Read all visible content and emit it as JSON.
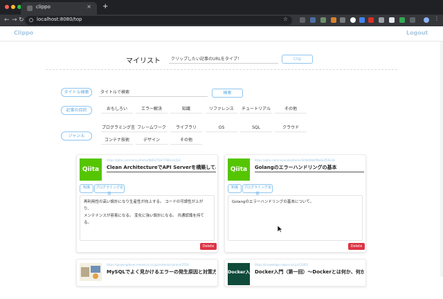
{
  "browser": {
    "tab_title": "clippo",
    "tab_close": "×",
    "new_tab": "+",
    "url": "localhost:8080/top",
    "back": "←",
    "forward": "→",
    "reload": "↻",
    "bookmark_star": "☆"
  },
  "header": {
    "brand": "Clippo",
    "logout": "Logout"
  },
  "clip_form": {
    "title": "マイリスト",
    "url_placeholder": "クリップしたい記事のURLをタイプ！",
    "clip_button": "Clip"
  },
  "filters": {
    "title_search_label": "タイトル検索",
    "title_search_placeholder": "タイトルで検索",
    "search_button": "検索",
    "purpose_label": "記事の目的",
    "purposes": [
      "おもしろい",
      "エラー解決",
      "知識",
      "リファレンス",
      "チュートリアル",
      "その他"
    ],
    "genre_label": "ジャンル",
    "genres_row1": [
      "プログラミング言",
      "フレームワーク",
      "ライブラリ",
      "OS",
      "SQL",
      "クラウド"
    ],
    "genres_row2": [
      "コンテナ技術",
      "デザイン",
      "その他"
    ]
  },
  "articles": [
    {
      "logo": "Qiita",
      "url": "https://qiita.com/reirisu/items/fb6fe7f3b77d83ccb5a1",
      "title": "Clean ArchitectureでAPI Serverを構築してみる",
      "tags": [
        "知識",
        "プログラミング言語"
      ],
      "body_line1": "再利用性の高い設計になり生産性が向上する。 コードの可読性が上がり、",
      "body_line2": "メンテナンスが容易になる。 変化に強い設計になる。 共通認識を持てる。",
      "delete": "Delete"
    },
    {
      "logo": "Qiita",
      "url": "https://qiita.com/nayuneko/items/3c9dd0b4f9bda3f56e3d",
      "title": "Golangのエラーハンドリングの基本",
      "tags": [
        "知識",
        "プログラミング言語"
      ],
      "body_line1": "Golangのエラーハンドリングの基本について。",
      "body_line2": "",
      "delete": "Delete"
    },
    {
      "url": "https://growingdever.memocra.co.jp/contents/column/2554",
      "title": "MySQLでよく見かけるエラーの発生原因と対策方法"
    },
    {
      "logo": "Docker入門",
      "url": "https://knowledge.sakura.ad.jp/13265/",
      "title": "Docker入門（第一回）〜Dockerとは何か、何が良い"
    }
  ],
  "colors": {
    "accent": "#8ec5ef",
    "delete": "#dc3545",
    "qiita": "#55c500"
  }
}
